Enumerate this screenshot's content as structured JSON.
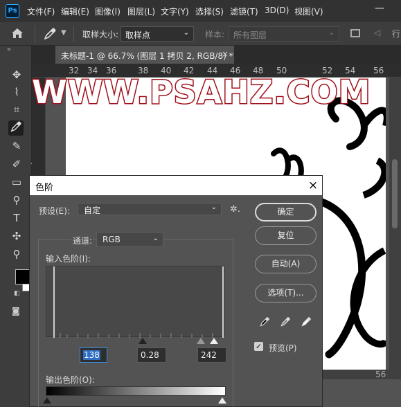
{
  "app": {
    "logo": "Ps"
  },
  "menu": [
    "文件(F)",
    "编辑(E)",
    "图像(I)",
    "图层(L)",
    "文字(Y)",
    "选择(S)",
    "滤镜(T)",
    "3D(D)",
    "视图(V)"
  ],
  "window_controls": {
    "minimize": "—"
  },
  "options_bar": {
    "sample_size_label": "取样大小:",
    "sample_size_value": "取样点",
    "sample_label": "样本:",
    "sample_value": "所有图层",
    "truncated_text": "行"
  },
  "tab": {
    "title": "未标题-1 @ 66.7% (图层 1 拷贝 2, RGB/8) *",
    "close": "×"
  },
  "ruler": {
    "ticks": [
      "32",
      "34",
      "36",
      "38",
      "40",
      "42",
      "44",
      "46",
      "48",
      "50",
      "52",
      "54",
      "56"
    ]
  },
  "watermark": "WWW.PSAHZ.COM",
  "scroll_h_text": "56",
  "dialog": {
    "title": "色阶",
    "close": "×",
    "preset_label": "预设(E):",
    "preset_value": "自定",
    "channel_label": "通道:",
    "channel_value": "RGB",
    "input_levels_label": "输入色阶(I):",
    "input_black": "138",
    "input_gamma": "0.28",
    "input_white": "242",
    "output_levels_label": "输出色阶(O):",
    "buttons": {
      "ok": "确定",
      "reset": "复位",
      "auto": "自动(A)",
      "options": "选项(T)..."
    },
    "preview_label": "预览(P)",
    "preview_checked": true
  },
  "colors": {
    "foreground": "#000000",
    "background": "#ffffff",
    "watermark_outline": "#a0101a"
  }
}
